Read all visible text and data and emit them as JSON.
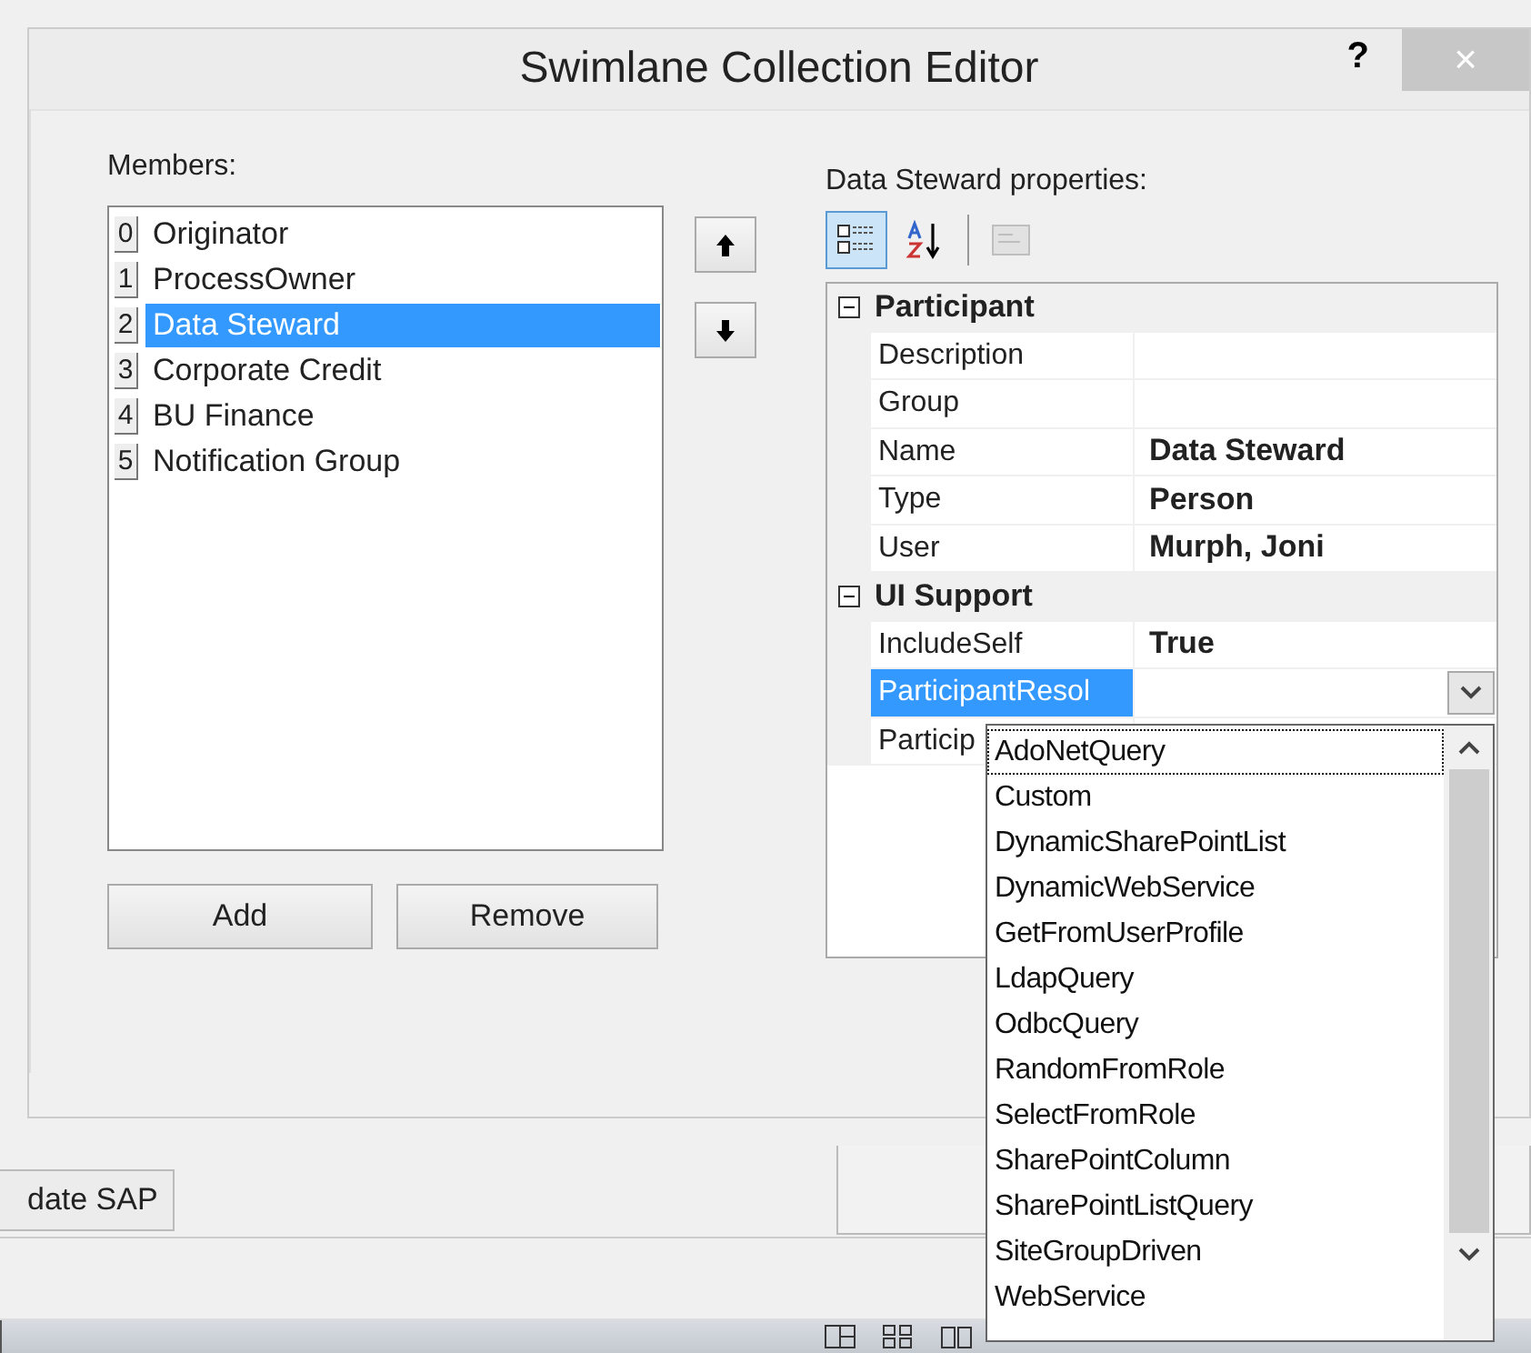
{
  "dialog": {
    "title": "Swimlane Collection Editor",
    "help": "?",
    "close": "×"
  },
  "members": {
    "label": "Members:",
    "items": [
      {
        "index": "0",
        "name": "Originator",
        "selected": false
      },
      {
        "index": "1",
        "name": "ProcessOwner",
        "selected": false
      },
      {
        "index": "2",
        "name": "Data Steward",
        "selected": true
      },
      {
        "index": "3",
        "name": "Corporate Credit",
        "selected": false
      },
      {
        "index": "4",
        "name": "BU Finance",
        "selected": false
      },
      {
        "index": "5",
        "name": "Notification Group",
        "selected": false
      }
    ]
  },
  "move_buttons": [
    {
      "kind": "up"
    },
    {
      "kind": "down"
    }
  ],
  "buttons": [
    "Add",
    "Remove"
  ],
  "properties": {
    "label": "Data Steward properties:",
    "toolbar": [
      {
        "kind": "categorized",
        "selected": true,
        "disabled": false
      },
      {
        "kind": "alphabetical",
        "selected": false,
        "disabled": false
      },
      {
        "kind": "pages",
        "selected": false,
        "disabled": true
      }
    ],
    "categories": [
      {
        "name": "Participant",
        "expanded": true,
        "rows": [
          {
            "name": "Description",
            "selected": false
          },
          {
            "name": "Group",
            "selected": false
          },
          {
            "name": "Name",
            "value": "Data Steward",
            "selected": false
          },
          {
            "name": "Type",
            "value": "Person",
            "selected": false
          },
          {
            "name": "User",
            "value": "Murph, Joni",
            "selected": false
          }
        ]
      },
      {
        "name": "UI Support",
        "expanded": true,
        "rows": [
          {
            "name": "IncludeSelf",
            "value": "True",
            "selected": false
          },
          {
            "name": "ParticipantResol",
            "selected": true,
            "dropdown": true
          },
          {
            "name": "Particip",
            "selected": false
          }
        ]
      }
    ]
  },
  "dropdown": {
    "options": [
      {
        "label": "AdoNetQuery",
        "focused": true
      },
      {
        "label": "Custom",
        "focused": false
      },
      {
        "label": "DynamicSharePointList",
        "focused": false
      },
      {
        "label": "DynamicWebService",
        "focused": false
      },
      {
        "label": "GetFromUserProfile",
        "focused": false
      },
      {
        "label": "LdapQuery",
        "focused": false
      },
      {
        "label": "OdbcQuery",
        "focused": false
      },
      {
        "label": "RandomFromRole",
        "focused": false
      },
      {
        "label": "SelectFromRole",
        "focused": false
      },
      {
        "label": "SharePointColumn",
        "focused": false
      },
      {
        "label": "SharePointListQuery",
        "focused": false
      },
      {
        "label": "SiteGroupDriven",
        "focused": false
      },
      {
        "label": "WebService",
        "focused": false
      }
    ]
  },
  "background": {
    "tab": "date SAP"
  }
}
